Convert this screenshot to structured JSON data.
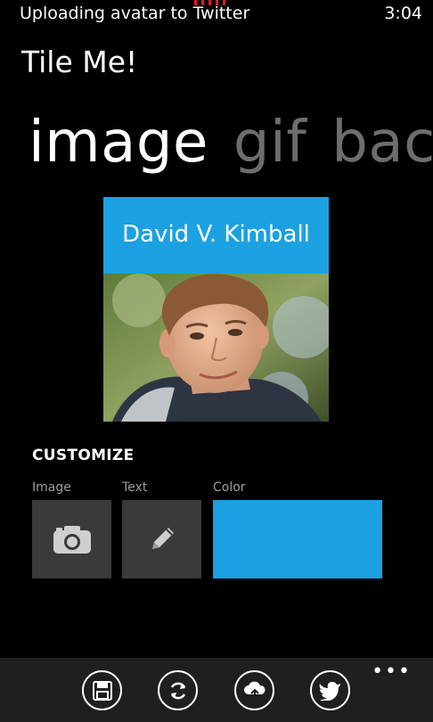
{
  "status": {
    "message": "Uploading avatar to Twitter",
    "time": "3:04"
  },
  "app": {
    "title": "Tile Me!"
  },
  "pivot": {
    "items": [
      "image",
      "gif",
      "bacl"
    ],
    "active_index": 0
  },
  "tile": {
    "name": "David V. Kimball",
    "banner_color": "#1ba1e2"
  },
  "customize": {
    "heading": "CUSTOMIZE",
    "image_label": "Image",
    "text_label": "Text",
    "color_label": "Color",
    "selected_color": "#1ba1e2"
  },
  "appbar": {
    "buttons": [
      "save-icon",
      "refresh-icon",
      "upload-cloud-icon",
      "twitter-icon"
    ],
    "more_label": "•••"
  }
}
